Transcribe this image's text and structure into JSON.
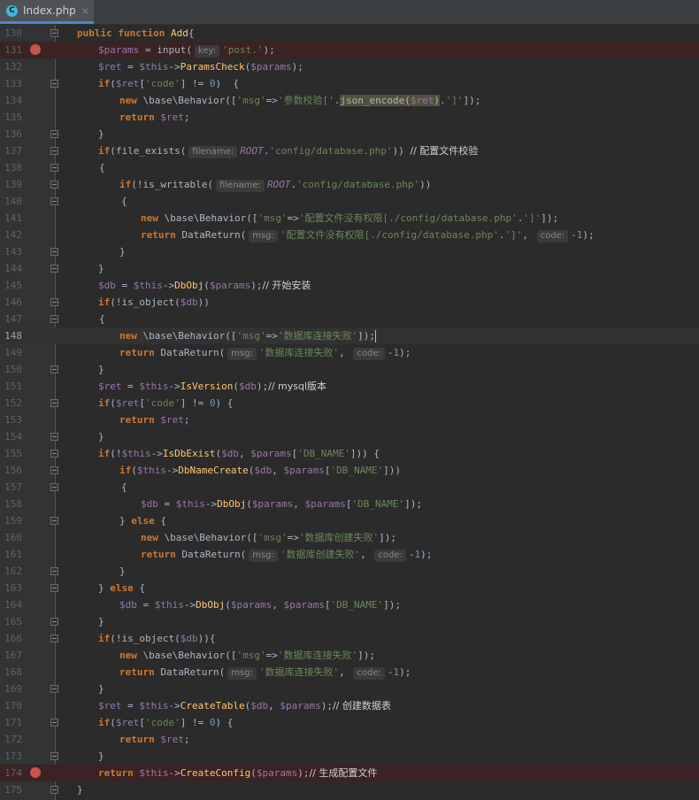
{
  "tab": {
    "label": "Index.php",
    "icon": "php-file-icon",
    "close": "×",
    "icon_letter": "C"
  },
  "code": {
    "lines": [
      {
        "n": "130",
        "fold": true,
        "t": [
          [
            "k",
            "public function"
          ],
          [
            "p",
            " "
          ],
          [
            "f",
            "Add"
          ],
          [
            "p",
            "{"
          ]
        ]
      },
      {
        "n": "131",
        "bp": true,
        "t": [
          [
            "v",
            "$params"
          ],
          [
            "p",
            " = input("
          ],
          [
            "h",
            "key:"
          ],
          [
            "s",
            "'post.'"
          ],
          [
            "p",
            ");"
          ]
        ]
      },
      {
        "n": "132",
        "t": [
          [
            "v",
            "$ret"
          ],
          [
            "p",
            " = "
          ],
          [
            "v",
            "$this"
          ],
          [
            "p",
            "->"
          ],
          [
            "f",
            "ParamsCheck"
          ],
          [
            "p",
            "("
          ],
          [
            "v",
            "$params"
          ],
          [
            "p",
            ");"
          ]
        ]
      },
      {
        "n": "133",
        "fold": true,
        "t": [
          [
            "k",
            "if"
          ],
          [
            "p",
            "("
          ],
          [
            "v",
            "$ret"
          ],
          [
            "p",
            "["
          ],
          [
            "s",
            "'code'"
          ],
          [
            "p",
            "] != "
          ],
          [
            "n",
            "0"
          ],
          [
            "p",
            ")  {"
          ]
        ]
      },
      {
        "n": "134",
        "t": [
          [
            "k",
            "new"
          ],
          [
            "p",
            " \\base\\Behavior(["
          ],
          [
            "s",
            "'msg'"
          ],
          [
            "p",
            "=>"
          ],
          [
            "s",
            "'参数校验['"
          ],
          [
            "p",
            "."
          ],
          [
            "hl",
            "json_encode("
          ],
          [
            "vhl",
            "$ret"
          ],
          [
            "hl",
            ")"
          ],
          [
            "p",
            "."
          ],
          [
            "s",
            "']'"
          ],
          [
            "p",
            "]);"
          ]
        ]
      },
      {
        "n": "135",
        "t": [
          [
            "k",
            "return"
          ],
          [
            "p",
            " "
          ],
          [
            "v",
            "$ret"
          ],
          [
            "p",
            ";"
          ]
        ]
      },
      {
        "n": "136",
        "fold": true,
        "t": [
          [
            "p",
            "}"
          ]
        ]
      },
      {
        "n": "137",
        "fold": true,
        "t": [
          [
            "k",
            "if"
          ],
          [
            "p",
            "(file_exists("
          ],
          [
            "h",
            "filename:"
          ],
          [
            "c",
            "ROOT"
          ],
          [
            "p",
            "."
          ],
          [
            "s",
            "'config/database.php'"
          ],
          [
            "p",
            ")) "
          ],
          [
            "m",
            "// 配置文件校验"
          ]
        ]
      },
      {
        "n": "138",
        "fold": true,
        "t": [
          [
            "p",
            "{"
          ]
        ]
      },
      {
        "n": "139",
        "fold": true,
        "t": [
          [
            "k",
            "if"
          ],
          [
            "p",
            "(!is_writable("
          ],
          [
            "h",
            "filename:"
          ],
          [
            "c",
            "ROOT"
          ],
          [
            "p",
            "."
          ],
          [
            "s",
            "'config/database.php'"
          ],
          [
            "p",
            "))"
          ]
        ]
      },
      {
        "n": "140",
        "fold": true,
        "t": [
          [
            "p",
            "{"
          ]
        ]
      },
      {
        "n": "141",
        "t": [
          [
            "k",
            "new"
          ],
          [
            "p",
            " \\base\\Behavior(["
          ],
          [
            "s",
            "'msg'"
          ],
          [
            "p",
            "=>"
          ],
          [
            "s",
            "'配置文件没有权限[./config/database.php'"
          ],
          [
            "p",
            "."
          ],
          [
            "s",
            "']'"
          ],
          [
            "p",
            "]);"
          ]
        ]
      },
      {
        "n": "142",
        "t": [
          [
            "k",
            "return"
          ],
          [
            "p",
            " DataReturn("
          ],
          [
            "h",
            "msg:"
          ],
          [
            "s",
            "'配置文件没有权限[./config/database.php'"
          ],
          [
            "p",
            "."
          ],
          [
            "s",
            "']'"
          ],
          [
            "p",
            ", "
          ],
          [
            "h",
            "code:"
          ],
          [
            "p",
            "-"
          ],
          [
            "n",
            "1"
          ],
          [
            "p",
            ");"
          ]
        ]
      },
      {
        "n": "143",
        "fold": true,
        "t": [
          [
            "p",
            "}"
          ]
        ]
      },
      {
        "n": "144",
        "fold": true,
        "t": [
          [
            "p",
            "}"
          ]
        ]
      },
      {
        "n": "145",
        "t": [
          [
            "v",
            "$db"
          ],
          [
            "p",
            " = "
          ],
          [
            "v",
            "$this"
          ],
          [
            "p",
            "->"
          ],
          [
            "f",
            "DbObj"
          ],
          [
            "p",
            "("
          ],
          [
            "v",
            "$params"
          ],
          [
            "p",
            ");"
          ],
          [
            "m",
            "// 开始安装"
          ]
        ]
      },
      {
        "n": "146",
        "fold": true,
        "t": [
          [
            "k",
            "if"
          ],
          [
            "p",
            "(!is_object("
          ],
          [
            "v",
            "$db"
          ],
          [
            "p",
            "))"
          ]
        ]
      },
      {
        "n": "147",
        "fold": true,
        "t": [
          [
            "p",
            "{"
          ]
        ]
      },
      {
        "n": "148",
        "cur": true,
        "t": [
          [
            "k",
            "new"
          ],
          [
            "p",
            " \\base\\Behavior(["
          ],
          [
            "s",
            "'msg'"
          ],
          [
            "p",
            "=>"
          ],
          [
            "s",
            "'数据库连接失败'"
          ],
          [
            "p",
            "]);"
          ],
          [
            "caret",
            ""
          ]
        ]
      },
      {
        "n": "149",
        "t": [
          [
            "k",
            "return"
          ],
          [
            "p",
            " DataReturn("
          ],
          [
            "h",
            "msg:"
          ],
          [
            "s",
            "'数据库连接失败'"
          ],
          [
            "p",
            ", "
          ],
          [
            "h",
            "code:"
          ],
          [
            "p",
            "-"
          ],
          [
            "n",
            "1"
          ],
          [
            "p",
            ");"
          ]
        ]
      },
      {
        "n": "150",
        "fold": true,
        "t": [
          [
            "p",
            "}"
          ]
        ]
      },
      {
        "n": "151",
        "t": [
          [
            "v",
            "$ret"
          ],
          [
            "p",
            " = "
          ],
          [
            "v",
            "$this"
          ],
          [
            "p",
            "->"
          ],
          [
            "f",
            "IsVersion"
          ],
          [
            "p",
            "("
          ],
          [
            "v",
            "$db"
          ],
          [
            "p",
            ");"
          ],
          [
            "m",
            "// mysql版本"
          ]
        ]
      },
      {
        "n": "152",
        "fold": true,
        "t": [
          [
            "k",
            "if"
          ],
          [
            "p",
            "("
          ],
          [
            "v",
            "$ret"
          ],
          [
            "p",
            "["
          ],
          [
            "s",
            "'code'"
          ],
          [
            "p",
            "] != "
          ],
          [
            "n",
            "0"
          ],
          [
            "p",
            ") {"
          ]
        ]
      },
      {
        "n": "153",
        "t": [
          [
            "k",
            "return"
          ],
          [
            "p",
            " "
          ],
          [
            "v",
            "$ret"
          ],
          [
            "p",
            ";"
          ]
        ]
      },
      {
        "n": "154",
        "fold": true,
        "t": [
          [
            "p",
            "}"
          ]
        ]
      },
      {
        "n": "155",
        "fold": true,
        "t": [
          [
            "k",
            "if"
          ],
          [
            "p",
            "(!"
          ],
          [
            "v",
            "$this"
          ],
          [
            "p",
            "->"
          ],
          [
            "f",
            "IsDbExist"
          ],
          [
            "p",
            "("
          ],
          [
            "v",
            "$db"
          ],
          [
            "p",
            ", "
          ],
          [
            "v",
            "$params"
          ],
          [
            "p",
            "["
          ],
          [
            "s",
            "'DB_NAME'"
          ],
          [
            "p",
            "])) {"
          ]
        ]
      },
      {
        "n": "156",
        "fold": true,
        "t": [
          [
            "k",
            "if"
          ],
          [
            "p",
            "("
          ],
          [
            "v",
            "$this"
          ],
          [
            "p",
            "->"
          ],
          [
            "f",
            "DbNameCreate"
          ],
          [
            "p",
            "("
          ],
          [
            "v",
            "$db"
          ],
          [
            "p",
            ", "
          ],
          [
            "v",
            "$params"
          ],
          [
            "p",
            "["
          ],
          [
            "s",
            "'DB_NAME'"
          ],
          [
            "p",
            "]))"
          ]
        ]
      },
      {
        "n": "157",
        "fold": true,
        "t": [
          [
            "p",
            "{"
          ]
        ]
      },
      {
        "n": "158",
        "t": [
          [
            "v",
            "$db"
          ],
          [
            "p",
            " = "
          ],
          [
            "v",
            "$this"
          ],
          [
            "p",
            "->"
          ],
          [
            "f",
            "DbObj"
          ],
          [
            "p",
            "("
          ],
          [
            "v",
            "$params"
          ],
          [
            "p",
            ", "
          ],
          [
            "v",
            "$params"
          ],
          [
            "p",
            "["
          ],
          [
            "s",
            "'DB_NAME'"
          ],
          [
            "p",
            "]);"
          ]
        ]
      },
      {
        "n": "159",
        "fold": true,
        "t": [
          [
            "p",
            "} "
          ],
          [
            "k",
            "else"
          ],
          [
            "p",
            " {"
          ]
        ]
      },
      {
        "n": "160",
        "t": [
          [
            "k",
            "new"
          ],
          [
            "p",
            " \\base\\Behavior(["
          ],
          [
            "s",
            "'msg'"
          ],
          [
            "p",
            "=>"
          ],
          [
            "s",
            "'数据库创建失败'"
          ],
          [
            "p",
            "]);"
          ]
        ]
      },
      {
        "n": "161",
        "t": [
          [
            "k",
            "return"
          ],
          [
            "p",
            " DataReturn("
          ],
          [
            "h",
            "msg:"
          ],
          [
            "s",
            "'数据库创建失败'"
          ],
          [
            "p",
            ", "
          ],
          [
            "h",
            "code:"
          ],
          [
            "p",
            "-"
          ],
          [
            "n",
            "1"
          ],
          [
            "p",
            ");"
          ]
        ]
      },
      {
        "n": "162",
        "fold": true,
        "t": [
          [
            "p",
            "}"
          ]
        ]
      },
      {
        "n": "163",
        "fold": true,
        "t": [
          [
            "p",
            "} "
          ],
          [
            "k",
            "else"
          ],
          [
            "p",
            " {"
          ]
        ]
      },
      {
        "n": "164",
        "t": [
          [
            "v",
            "$db"
          ],
          [
            "p",
            " = "
          ],
          [
            "v",
            "$this"
          ],
          [
            "p",
            "->"
          ],
          [
            "f",
            "DbObj"
          ],
          [
            "p",
            "("
          ],
          [
            "v",
            "$params"
          ],
          [
            "p",
            ", "
          ],
          [
            "v",
            "$params"
          ],
          [
            "p",
            "["
          ],
          [
            "s",
            "'DB_NAME'"
          ],
          [
            "p",
            "]);"
          ]
        ]
      },
      {
        "n": "165",
        "fold": true,
        "t": [
          [
            "p",
            "}"
          ]
        ]
      },
      {
        "n": "166",
        "fold": true,
        "t": [
          [
            "k",
            "if"
          ],
          [
            "p",
            "(!is_object("
          ],
          [
            "v",
            "$db"
          ],
          [
            "p",
            ")){"
          ]
        ]
      },
      {
        "n": "167",
        "t": [
          [
            "k",
            "new"
          ],
          [
            "p",
            " \\base\\Behavior(["
          ],
          [
            "s",
            "'msg'"
          ],
          [
            "p",
            "=>"
          ],
          [
            "s",
            "'数据库连接失败'"
          ],
          [
            "p",
            "]);"
          ]
        ]
      },
      {
        "n": "168",
        "t": [
          [
            "k",
            "return"
          ],
          [
            "p",
            " DataReturn("
          ],
          [
            "h",
            "msg:"
          ],
          [
            "s",
            "'数据库连接失败'"
          ],
          [
            "p",
            ", "
          ],
          [
            "h",
            "code:"
          ],
          [
            "p",
            "-"
          ],
          [
            "n",
            "1"
          ],
          [
            "p",
            ");"
          ]
        ]
      },
      {
        "n": "169",
        "fold": true,
        "t": [
          [
            "p",
            "}"
          ]
        ]
      },
      {
        "n": "170",
        "t": [
          [
            "v",
            "$ret"
          ],
          [
            "p",
            " = "
          ],
          [
            "v",
            "$this"
          ],
          [
            "p",
            "->"
          ],
          [
            "f",
            "CreateTable"
          ],
          [
            "p",
            "("
          ],
          [
            "v",
            "$db"
          ],
          [
            "p",
            ", "
          ],
          [
            "v",
            "$params"
          ],
          [
            "p",
            ");"
          ],
          [
            "m",
            "// 创建数据表"
          ]
        ]
      },
      {
        "n": "171",
        "fold": true,
        "t": [
          [
            "k",
            "if"
          ],
          [
            "p",
            "("
          ],
          [
            "v",
            "$ret"
          ],
          [
            "p",
            "["
          ],
          [
            "s",
            "'code'"
          ],
          [
            "p",
            "] != "
          ],
          [
            "n",
            "0"
          ],
          [
            "p",
            ") {"
          ]
        ]
      },
      {
        "n": "172",
        "t": [
          [
            "k",
            "return"
          ],
          [
            "p",
            " "
          ],
          [
            "v",
            "$ret"
          ],
          [
            "p",
            ";"
          ]
        ]
      },
      {
        "n": "173",
        "fold": true,
        "t": [
          [
            "p",
            "}"
          ]
        ]
      },
      {
        "n": "174",
        "bp": true,
        "t": [
          [
            "k",
            "return"
          ],
          [
            "p",
            " "
          ],
          [
            "v",
            "$this"
          ],
          [
            "p",
            "->"
          ],
          [
            "f",
            "CreateConfig"
          ],
          [
            "p",
            "("
          ],
          [
            "v",
            "$params"
          ],
          [
            "p",
            ");"
          ],
          [
            "m",
            "// 生成配置文件"
          ]
        ]
      },
      {
        "n": "175",
        "fold": true,
        "t": [
          [
            "p",
            "}"
          ]
        ]
      }
    ]
  }
}
